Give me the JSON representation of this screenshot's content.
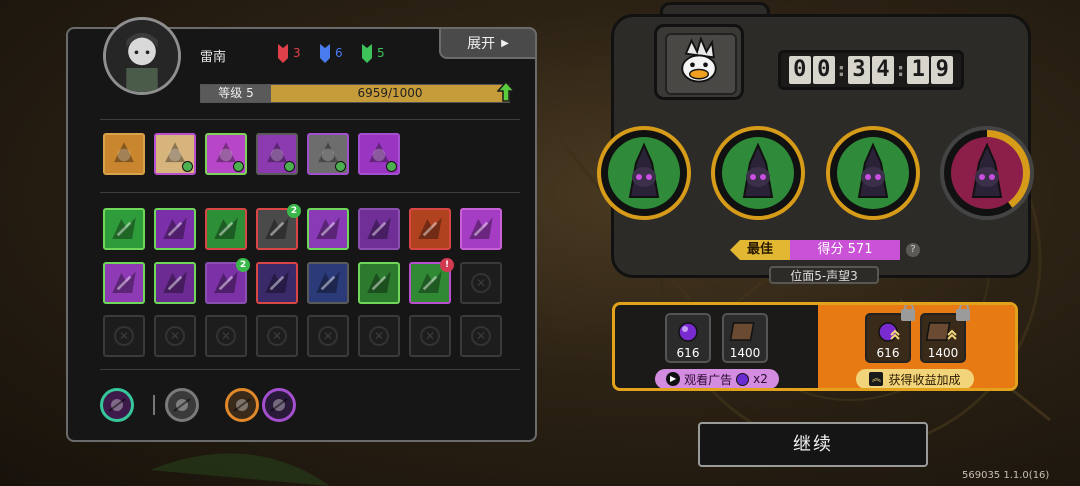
{
  "player": {
    "name": "雷南",
    "factions": [
      {
        "count": "3",
        "color": "#e0404a"
      },
      {
        "count": "6",
        "color": "#4a7cf0"
      },
      {
        "count": "5",
        "color": "#3ec25a"
      }
    ],
    "expand_label": "展开",
    "level_label": "等级 5",
    "xp_text": "6959/1000",
    "xp_fill": 1.0
  },
  "equipment": [
    {
      "icon": "golden-gauntlet-icon",
      "color": "#c9862f",
      "border": "#d7a24a"
    },
    {
      "icon": "skull-helmet-icon",
      "color": "#d6b47c",
      "border": "#b84fce"
    },
    {
      "icon": "claw-blade-icon",
      "color": "#b846c9",
      "border": "#7bd35a"
    },
    {
      "icon": "mech-armor-icon",
      "color": "#8c3ab0",
      "border": "#5b5b5b"
    },
    {
      "icon": "grey-shield-icon",
      "color": "#6d6d6d",
      "border": "#a34fd0"
    },
    {
      "icon": "purple-orb-icon",
      "color": "#9a35c2",
      "border": "#a34fd0"
    }
  ],
  "skills_row1": [
    {
      "icon": "green-diamond-icon",
      "color": "#2e9c3b",
      "border": "#6fd85a",
      "badge": ""
    },
    {
      "icon": "triple-claw-icon",
      "color": "#7b2fa8",
      "border": "#6fd85a",
      "badge": ""
    },
    {
      "icon": "green-shield-icon",
      "color": "#2d8f36",
      "border": "#d84646",
      "badge": ""
    },
    {
      "icon": "vault-icon",
      "color": "#4a4a4a",
      "border": "#d84646",
      "badge": "2"
    },
    {
      "icon": "scratch-icon",
      "color": "#8b3ab7",
      "border": "#6fd85a",
      "badge": ""
    },
    {
      "icon": "scythe-icon",
      "color": "#6f2f97",
      "border": "#8a4fb0",
      "badge": ""
    },
    {
      "icon": "fire-slash-icon",
      "color": "#b0421f",
      "border": "#d84646",
      "badge": ""
    },
    {
      "icon": "slime-icon",
      "color": "#a53cc4",
      "border": "#c860d8",
      "badge": ""
    }
  ],
  "skills_row2": [
    {
      "icon": "vortex-icon",
      "color": "#8f3ab5",
      "border": "#6fd85a",
      "badge": ""
    },
    {
      "icon": "cross-slash-icon",
      "color": "#6c2b92",
      "border": "#6fd85a",
      "badge": ""
    },
    {
      "icon": "spiky-creature-icon",
      "color": "#7c31a7",
      "border": "#8a4fb0",
      "badge": "2"
    },
    {
      "icon": "masked-hero-icon",
      "color": "#3a2a6a",
      "border": "#d84646",
      "badge": ""
    },
    {
      "icon": "beast-face-icon",
      "color": "#2b3b7a",
      "border": "#5a5a5a",
      "badge": ""
    },
    {
      "icon": "green-legs-icon",
      "color": "#2b7a2e",
      "border": "#6fd85a",
      "badge": ""
    },
    {
      "icon": "green-legs-alt-icon",
      "color": "#2f8a33",
      "border": "#b84fce",
      "badge": "!"
    },
    {
      "icon": "empty-slot-icon",
      "color": "",
      "border": "",
      "badge": ""
    }
  ],
  "skills_row3_empty": 8,
  "bottom_icons": [
    {
      "icon": "swirl-ring-icon",
      "border": "#37c59a",
      "bg": "#3d1a4a"
    },
    {
      "icon": "bullets-icon",
      "border": "#7a7a7a",
      "bg": "#3a3a3a"
    },
    {
      "icon": "crossed-blades-icon",
      "border": "#e0882a",
      "bg": "#3a2a1a"
    },
    {
      "icon": "witch-hat-icon",
      "border": "#a34fd0",
      "bg": "#2a1a3a"
    }
  ],
  "timer": {
    "digits": [
      "0",
      "0",
      "3",
      "4",
      "1",
      "9"
    ]
  },
  "enemies": [
    {
      "icon": "hooded-assassin-icon",
      "ring": "#d79b1a",
      "bg": "#2f8a39",
      "progress": 1.0
    },
    {
      "icon": "armored-mask-icon",
      "ring": "#d79b1a",
      "bg": "#2f8a39",
      "progress": 1.0
    },
    {
      "icon": "horned-demon-icon",
      "ring": "#d79b1a",
      "bg": "#2f8a39",
      "progress": 1.0
    },
    {
      "icon": "pink-demon-icon",
      "ring": "#d79b1a",
      "bg": "#8b1f4a",
      "progress": 0.4
    }
  ],
  "score": {
    "best_label": "最佳",
    "score_label": "得分 571",
    "help": "?"
  },
  "stage": "位面5-声望3",
  "rewards": {
    "items": [
      {
        "icon": "purple-gem-icon",
        "value": "616"
      },
      {
        "icon": "brown-book-icon",
        "value": "1400"
      }
    ],
    "boost_items": [
      {
        "icon": "purple-gem-icon",
        "value": "616"
      },
      {
        "icon": "brown-book-icon",
        "value": "1400"
      }
    ],
    "ad_label": "观看广告",
    "ad_multiplier": "x2",
    "boost_label": "获得收益加成"
  },
  "continue_label": "继续",
  "version": "569035 1.1.0(16)"
}
